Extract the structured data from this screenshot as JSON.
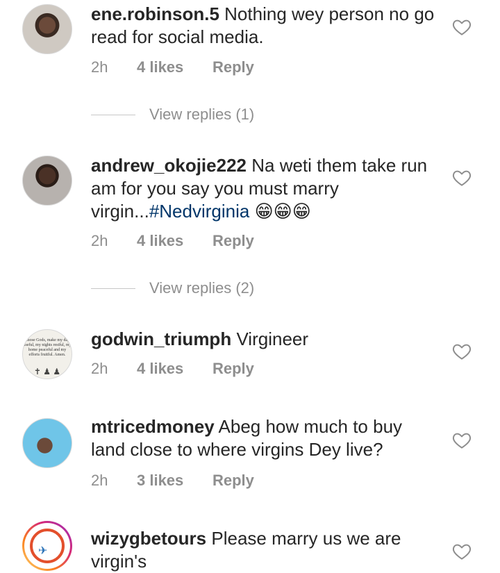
{
  "comments": [
    {
      "username": "ene.robinson.5",
      "text": "Nothing wey person no go read for social media.",
      "hashtag": "",
      "emoji": "",
      "time": "2h",
      "likes": "4 likes",
      "reply": "Reply",
      "avatar_icon": "woman-portrait-icon"
    },
    {
      "username": "andrew_okojie222",
      "text": "Na weti them take run am for you say you must marry virgin...",
      "hashtag": "#Nedvirginia",
      "emoji": "😁😁😁",
      "time": "2h",
      "likes": "4 likes",
      "reply": "Reply",
      "avatar_icon": "man-portrait-icon"
    },
    {
      "username": "godwin_triumph",
      "text": "Virgineer",
      "hashtag": "",
      "emoji": "",
      "time": "2h",
      "likes": "4 likes",
      "reply": "Reply",
      "avatar_icon": "prayer-quote-image-icon",
      "avatar_text": "...those Gods, make my days useful, my nights restful, my home peaceful and my efforts fruitful. Amen."
    },
    {
      "username": "mtricedmoney",
      "text": "Abeg how much to buy land close to where virgins Dey live?",
      "hashtag": "",
      "emoji": "",
      "time": "2h",
      "likes": "3 likes",
      "reply": "Reply",
      "avatar_icon": "man-selfie-icon"
    },
    {
      "username": "wizygbetours",
      "text": "Please marry us we are virgin's",
      "hashtag": "",
      "emoji": "",
      "time": "",
      "likes": "",
      "reply": "",
      "avatar_icon": "travel-logo-icon"
    }
  ],
  "view_replies": [
    {
      "label": "View replies (1)"
    },
    {
      "label": "View replies (2)"
    }
  ],
  "icons": {
    "like": "heart-outline-icon"
  },
  "colors": {
    "text": "#262626",
    "meta": "#8e8e8e",
    "hashtag": "#003569",
    "divider": "#c7c7c7"
  }
}
